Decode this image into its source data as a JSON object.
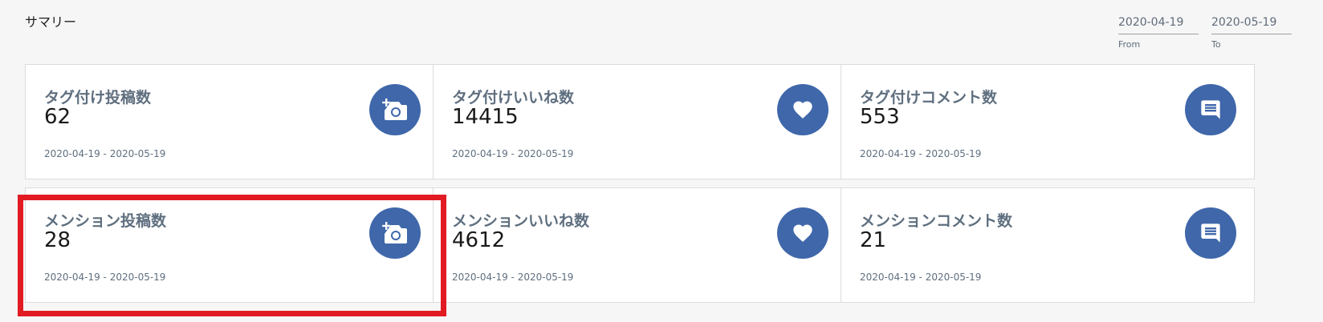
{
  "summary": {
    "title": "サマリー"
  },
  "filters": {
    "from": {
      "value": "2020-04-19",
      "label": "From"
    },
    "to": {
      "value": "2020-05-19",
      "label": "To"
    }
  },
  "cards": [
    {
      "label": "タグ付け投稿数",
      "value": "62",
      "range": "2020-04-19 - 2020-05-19",
      "icon": "add-photo-icon"
    },
    {
      "label": "タグ付けいいね数",
      "value": "14415",
      "range": "2020-04-19 - 2020-05-19",
      "icon": "heart-icon"
    },
    {
      "label": "タグ付けコメント数",
      "value": "553",
      "range": "2020-04-19 - 2020-05-19",
      "icon": "comment-icon"
    },
    {
      "label": "メンション投稿数",
      "value": "28",
      "range": "2020-04-19 - 2020-05-19",
      "icon": "add-photo-icon"
    },
    {
      "label": "メンションいいね数",
      "value": "4612",
      "range": "2020-04-19 - 2020-05-19",
      "icon": "heart-icon"
    },
    {
      "label": "メンションコメント数",
      "value": "21",
      "range": "2020-04-19 - 2020-05-19",
      "icon": "comment-icon"
    }
  ],
  "colors": {
    "accent": "#3f67aa",
    "highlight": "#e21b23"
  }
}
